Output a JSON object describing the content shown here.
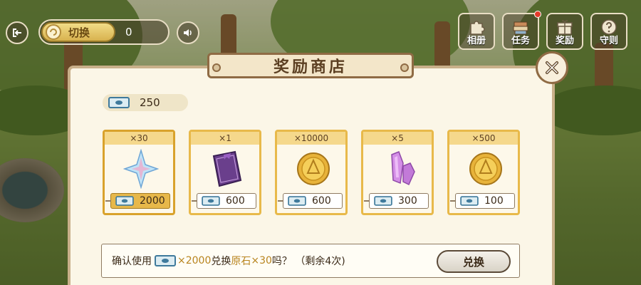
{
  "hud": {
    "switch_label": "切换",
    "switch_count": "0",
    "menu": [
      {
        "label": "相册",
        "icon": "puzzle-icon"
      },
      {
        "label": "任务",
        "icon": "book-stack-icon",
        "badge": true
      },
      {
        "label": "奖励",
        "icon": "gift-box-icon"
      },
      {
        "label": "守则",
        "icon": "question-icon"
      }
    ]
  },
  "shop": {
    "title": "奖励商店",
    "balance": "250",
    "items": [
      {
        "qty": "×30",
        "price": "2000",
        "icon": "primogem-star-icon",
        "selected": true
      },
      {
        "qty": "×1",
        "price": "600",
        "icon": "purple-book-icon"
      },
      {
        "qty": "×10000",
        "price": "600",
        "icon": "gold-coin-icon"
      },
      {
        "qty": "×5",
        "price": "300",
        "icon": "purple-crystal-icon"
      },
      {
        "qty": "×500",
        "price": "100",
        "icon": "gold-coin-icon"
      }
    ],
    "confirm": {
      "prefix": "确认使用",
      "cost": "×2000",
      "mid": "兑换",
      "item_name": "原石",
      "item_qty": " ×30",
      "suffix": "吗？ （剩余4次)",
      "button": "兑换"
    }
  },
  "colors": {
    "accent_gold": "#e8b94a",
    "panel_bg": "#fbf6e7",
    "frame_brown": "#8f6b44",
    "ticket_blue": "#3f7a9c"
  }
}
